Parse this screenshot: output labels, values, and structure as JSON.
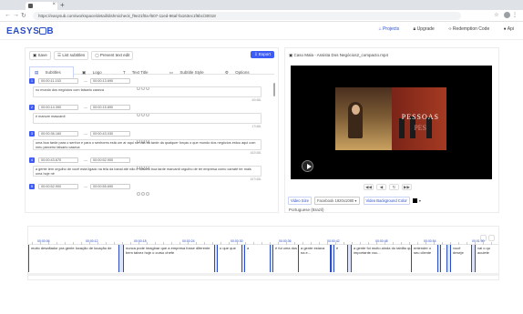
{
  "browser": {
    "url": "https://easysub.com/workspace/detail/dishmicheck_f9e21f0a-f607-11ed-96af-fa163ec1f6bc/30018"
  },
  "header": {
    "logo": "EASYSUB",
    "nav": [
      {
        "icon": "home-icon",
        "label": "Projects",
        "active": true
      },
      {
        "icon": "lock-icon",
        "label": "Upgrade",
        "active": false
      },
      {
        "icon": "code-icon",
        "label": "Redemption Code",
        "active": false
      },
      {
        "icon": "github-icon",
        "label": "Api",
        "active": false
      }
    ]
  },
  "toolbar": {
    "save": "Save",
    "list_subtitles": "List subtitles",
    "prevent_text_edit": "Prevent text edit",
    "export": "Export"
  },
  "tabs": [
    "Subtitles",
    "Logo",
    "Text Title",
    "Subtitle Style",
    "Options"
  ],
  "subtitles": [
    {
      "n": "1",
      "start": "00:00:11.153",
      "end": "00:00:13.690",
      "text": "no mundo dos negócios com falsario caseca",
      "count": "40/48L"
    },
    {
      "n": "2",
      "start": "00:00:14.390",
      "end": "00:00:15.890",
      "text": "é manure mascardi",
      "count": "17/48L"
    },
    {
      "n": "3",
      "start": "00:00:36.160",
      "end": "00:00:43.030",
      "text": "uma boa tarde para o senhor e para o senhores está um ar aqui na raia da tarde da qualquer forças o que mundo dos negócios estou aqui com meu parceiro falsario caseca",
      "count": "162/48L"
    },
    {
      "n": "4",
      "start": "00:00:43.670",
      "end": "00:00:52.900",
      "text": "a gente tem orgulho de você está ligado na tela da banal até não é falsario boa tarde marcardi orgulho de ter empresa como carraté ter mais uma hoje né",
      "count": "157/48L"
    },
    {
      "n": "5",
      "start": "00:00:52.900",
      "end": "00:00:55.690",
      "text": "",
      "count": ""
    }
  ],
  "preview": {
    "title": "Caso Mala - Assista Dos Negócios2_compacto.mp4",
    "video_text": "PESSOAS",
    "video_text_2": "PES",
    "video_size_label": "Video Size",
    "video_size_value": "Facebook 1920x1080",
    "bg_color_label": "Video Background Color",
    "language": "Portuguese (Brazil)"
  },
  "timeline": {
    "markers": [
      "00:00:06",
      "00:00:12",
      "00:00:18",
      "00:00:24",
      "00:00:30",
      "00:00:36",
      "00:00:42",
      "00:00:48",
      "00:00:54",
      "00:01:00"
    ],
    "segments": [
      {
        "text": "muito desafiador pra gente locação de locação de"
      },
      {
        "text": "nunca pode imaginar que a empresa fosse diferente bem talvez hoje o curso chefe"
      },
      {
        "text": "o que que"
      },
      {
        "text": "a"
      },
      {
        "text": "é fui uma dos duas anos atrás"
      },
      {
        "text": "a gente estava na e..."
      },
      {
        "text": "é"
      },
      {
        "text": "a gente foi muito ainda do tablão que é importante voc..."
      },
      {
        "text": "entender o seu cliente"
      },
      {
        "text": "..."
      },
      {
        "text": "você deseje"
      },
      {
        "text": "vai o qu acuiete"
      }
    ]
  },
  "colors": {
    "accent": "#2b4cc7",
    "export_button": "#3d5cf5"
  }
}
